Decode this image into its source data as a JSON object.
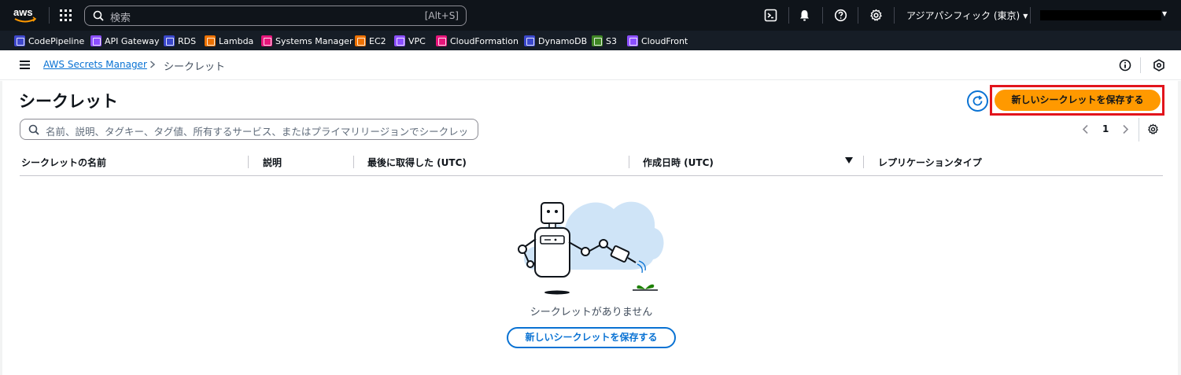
{
  "topnav": {
    "logo_text": "aws",
    "search_placeholder": "検索",
    "search_shortcut": "[Alt+S]",
    "region": "アジアパシフィック (東京)",
    "icons": [
      "services-grid-icon",
      "search-icon",
      "cloudshell-icon",
      "bell-icon",
      "help-icon",
      "gear-icon"
    ]
  },
  "favorites": [
    {
      "label": "CodePipeline",
      "color": "#3f48cc"
    },
    {
      "label": "API Gateway",
      "color": "#8c4fff"
    },
    {
      "label": "RDS",
      "color": "#3b48cc"
    },
    {
      "label": "Lambda",
      "color": "#ed7100"
    },
    {
      "label": "Systems Manager",
      "color": "#e7157b"
    },
    {
      "label": "EC2",
      "color": "#ed7100"
    },
    {
      "label": "VPC",
      "color": "#8c4fff"
    },
    {
      "label": "CloudFormation",
      "color": "#e7157b"
    },
    {
      "label": "DynamoDB",
      "color": "#3b48cc"
    },
    {
      "label": "S3",
      "color": "#3f8624"
    },
    {
      "label": "CloudFront",
      "color": "#8c4fff"
    }
  ],
  "breadcrumb": {
    "service": "AWS Secrets Manager",
    "current": "シークレット"
  },
  "page": {
    "title": "シークレット",
    "primary_button": "新しいシークレットを保存する",
    "filter_placeholder": "名前、説明、タグキー、タグ値、所有するサービス、またはプライマリリージョンでシークレットをフィルタリング",
    "page_number": "1"
  },
  "table": {
    "columns": [
      "シークレットの名前",
      "説明",
      "最後に取得した (UTC)",
      "作成日時 (UTC)",
      "レプリケーションタイプ"
    ],
    "sorted_column": "作成日時 (UTC)",
    "sort_direction": "descending",
    "rows": []
  },
  "empty_state": {
    "message": "シークレットがありません",
    "button": "新しいシークレットを保存する"
  },
  "colors": {
    "nav_bg": "#0f141a",
    "accent": "#ff9900",
    "link": "#0972d3",
    "highlight": "#e2141c"
  }
}
